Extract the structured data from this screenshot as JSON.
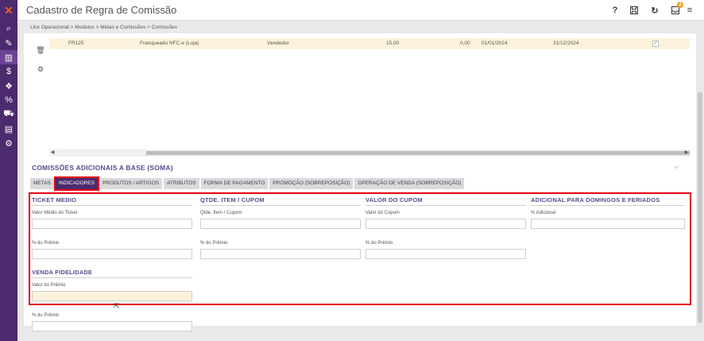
{
  "header": {
    "title": "Cadastro de Regra de Comissão",
    "help_label": "?",
    "notif_count": "2"
  },
  "breadcrumb": [
    "Linx Operacional",
    "Modulos",
    "Metas e Comissões",
    "Comissões"
  ],
  "grid": {
    "row": {
      "code": "FR125",
      "store": "Franqueado NFC-e (Loja)",
      "role": "Vendedor",
      "value1": "15,00",
      "value2": "0,00",
      "start": "01/01/2024",
      "end": "31/12/2024",
      "checked": "✓"
    }
  },
  "section": {
    "title": "COMISSÕES ADICIONAIS A BASE (SOMA)"
  },
  "tabs": [
    {
      "label": "METAS"
    },
    {
      "label": "INDICADORES"
    },
    {
      "label": "PRODUTOS / ARTIGOS"
    },
    {
      "label": "ATRIBUTOS"
    },
    {
      "label": "FORMA DE PAGAMENTO"
    },
    {
      "label": "PROMOÇÃO (SOBREPOSIÇÃO)"
    },
    {
      "label": "OPERAÇÃO DE VENDA (SOBREPOSIÇÃO)"
    }
  ],
  "active_tab": "INDICADORES",
  "form": {
    "ticket": {
      "title": "TICKET MEDIO",
      "field1_label": "Valor Médio do Ticket",
      "field1_value": "",
      "field2_label": "% do Prêmio",
      "field2_value": ""
    },
    "qtde": {
      "title": "QTDE. ITEM / CUPOM",
      "field1_label": "Qtde. Item / Cupom",
      "field1_value": "",
      "field2_label": "% do Prêmio",
      "field2_value": ""
    },
    "cupom": {
      "title": "VALOR DO CUPOM",
      "field1_label": "Valor do Cupom",
      "field1_value": "",
      "field2_label": "% do Prêmio",
      "field2_value": ""
    },
    "adicional": {
      "title": "ADICIONAL PARA DOMINGOS E FERIADOS",
      "field1_label": "% Adicional",
      "field1_value": ""
    },
    "fidelidade": {
      "title": "VENDA FIDELIDADE",
      "field1_label": "Valor do Prêmio",
      "field1_value": "",
      "field2_label": "% do Prêmio",
      "field2_value": ""
    }
  },
  "colors": {
    "sidebar": "#4b2a6e",
    "accent_title": "#5a4a8a",
    "highlight_border": "#e3000f",
    "row_highlight": "#fcf2dc"
  }
}
